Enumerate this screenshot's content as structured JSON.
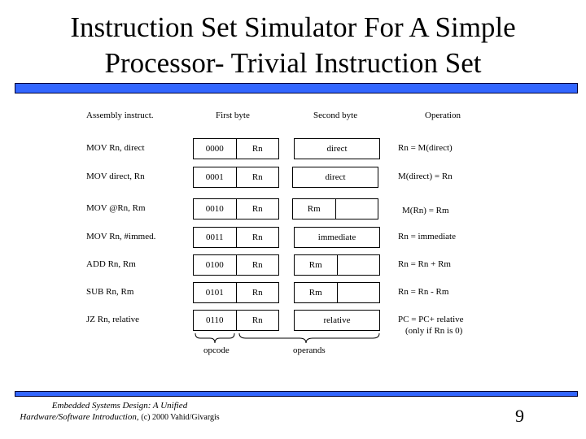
{
  "slide": {
    "title_line1": "Instruction Set Simulator For A Simple",
    "title_line2": "Processor- Trivial Instruction Set",
    "page_number": "9",
    "accent_color": "#3366ff"
  },
  "table": {
    "headers": {
      "assembly": "Assembly instruct.",
      "first_byte": "First byte",
      "second_byte": "Second byte",
      "operation": "Operation"
    },
    "rows": [
      {
        "assembly": "MOV Rn, direct",
        "opcode": "0000",
        "reg": "Rn",
        "second": [
          "direct"
        ],
        "operation": "Rn = M(direct)",
        "operation_note": ""
      },
      {
        "assembly": "MOV direct, Rn",
        "opcode": "0001",
        "reg": "Rn",
        "second": [
          "direct"
        ],
        "operation": "M(direct) = Rn",
        "operation_note": ""
      },
      {
        "assembly": "MOV @Rn, Rm",
        "opcode": "0010",
        "reg": "Rn",
        "second": [
          "Rm",
          ""
        ],
        "operation": "M(Rn) = Rm",
        "operation_note": ""
      },
      {
        "assembly": "MOV Rn, #immed.",
        "opcode": "0011",
        "reg": "Rn",
        "second": [
          "immediate"
        ],
        "operation": "Rn = immediate",
        "operation_note": ""
      },
      {
        "assembly": "ADD Rn, Rm",
        "opcode": "0100",
        "reg": "Rn",
        "second": [
          "Rm",
          ""
        ],
        "operation": "Rn = Rn + Rm",
        "operation_note": ""
      },
      {
        "assembly": "SUB Rn, Rm",
        "opcode": "0101",
        "reg": "Rn",
        "second": [
          "Rm",
          ""
        ],
        "operation": "Rn = Rn - Rm",
        "operation_note": ""
      },
      {
        "assembly": "JZ  Rn, relative",
        "opcode": "0110",
        "reg": "Rn",
        "second": [
          "relative"
        ],
        "operation": "PC = PC+ relative",
        "operation_note": "(only if Rn is 0)"
      }
    ],
    "brace_labels": {
      "opcode": "opcode",
      "operands": "operands"
    }
  },
  "footer": {
    "book_line1": "Embedded Systems Design: A Unified",
    "book_line2": "Hardware/Software Introduction,",
    "copyright": "(c) 2000 Vahid/Givargis"
  }
}
